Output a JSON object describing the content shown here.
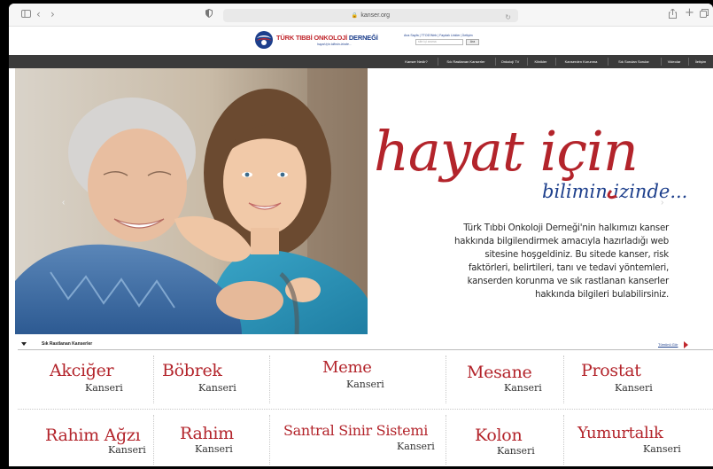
{
  "browser": {
    "url": "kanser.org",
    "icons": [
      "sidebar-icon",
      "back-icon",
      "forward-icon",
      "privacy-shield-icon",
      "reload-icon",
      "share-icon",
      "new-tab-icon",
      "tabs-icon"
    ]
  },
  "header": {
    "logo_red": "TÜRK TIBBİ ONKOLOJİ",
    "logo_blue": "DERNEĞİ",
    "logo_tag": "hayat için bilimin izinde...",
    "top_links": "Ana Sayfa | TTOD'Web | Faydalı Linkler | İletişim",
    "search_placeholder": "site içi arama",
    "search_button": "Ara"
  },
  "nav": {
    "items": [
      "Kanser Nedir?",
      "Sık Rastlanan Kanserler",
      "Onkoloji TV",
      "Klinikler",
      "Kanserden Korunma",
      "Sık Sorulan Sorular",
      "Videolar",
      "İletişim"
    ]
  },
  "hero": {
    "script_main": "hayat için",
    "script_sub": "bilimin izinde...",
    "text": "Türk Tıbbi Onkoloji Derneği'nin halkımızı kanser hakkında bilgilendirmek amacıyla hazırladığı web sitesine hoşgeldiniz. Bu sitede kanser, risk faktörleri, belirtileri, tanı ve tedavi yöntemleri, kanserden korunma ve sık rastlanan kanserler hakkında bilgileri bulabilirsiniz.",
    "prev": "‹",
    "next": "›"
  },
  "cancers": {
    "title": "Sık Rastlanan Kanserler",
    "see_all": "Tümünü Gör",
    "suffix": "Kanseri",
    "row1": [
      "Akciğer",
      "Böbrek",
      "Meme",
      "Mesane",
      "Prostat"
    ],
    "row2": [
      "Rahim Ağzı",
      "Rahim",
      "Santral Sinir Sistemi",
      "Kolon",
      "Yumurtalık"
    ]
  },
  "colors": {
    "accent_red": "#b3242b",
    "brand_blue": "#1d3f8c",
    "nav_bg": "#3b3b3b"
  }
}
